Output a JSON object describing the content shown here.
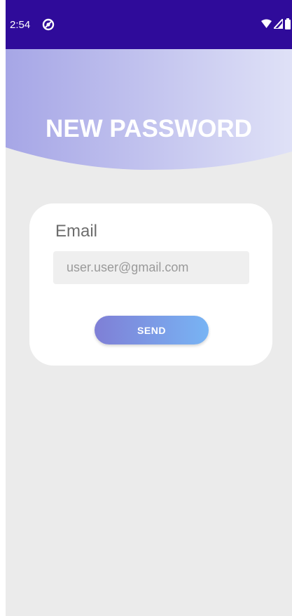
{
  "status_bar": {
    "time": "2:54",
    "background_color": "#2f0b9a",
    "icons": [
      "app-notification-icon",
      "wifi-icon",
      "signal-icon",
      "battery-icon"
    ]
  },
  "header": {
    "title": "NEW PASSWORD",
    "gradient_colors": [
      "#a6a6e6",
      "#dfe1f7"
    ]
  },
  "form": {
    "email_label": "Email",
    "email_placeholder": "user.user@gmail.com",
    "email_value": "",
    "send_label": "SEND",
    "button_gradient": [
      "#7f7fd6",
      "#78b4f4"
    ]
  },
  "colors": {
    "page_background": "#ebebeb",
    "card_background": "#ffffff"
  }
}
